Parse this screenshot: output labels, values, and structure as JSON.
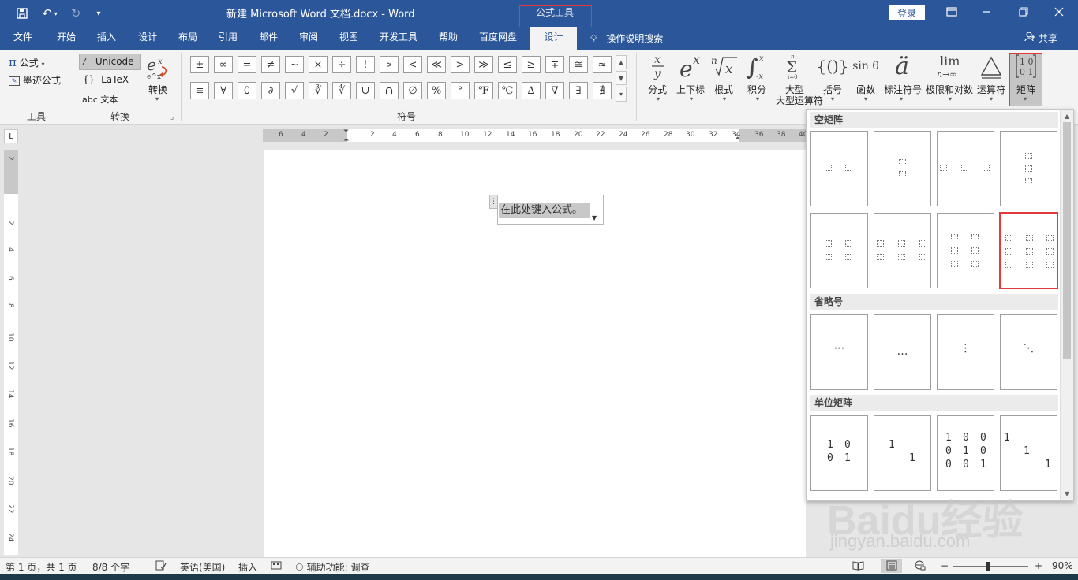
{
  "titlebar": {
    "doc_title": "新建 Microsoft Word 文档.docx  -  Word",
    "context_tool": "公式工具",
    "login": "登录"
  },
  "tabs": [
    "文件",
    "开始",
    "插入",
    "设计",
    "布局",
    "引用",
    "邮件",
    "审阅",
    "视图",
    "开发工具",
    "帮助",
    "百度网盘",
    "设计"
  ],
  "active_tab": "设计",
  "tell_me": "操作说明搜索",
  "share": "共享",
  "ribbon": {
    "tools": {
      "equation": "公式",
      "ink_equation": "墨迹公式",
      "group": "工具"
    },
    "conversions": {
      "unicode": "Unicode",
      "latex": "LaTeX",
      "text": "abc 文本",
      "convert": "转换",
      "group": "转换"
    },
    "symbols": {
      "group": "符号",
      "row1": [
        "±",
        "∞",
        "=",
        "≠",
        "~",
        "×",
        "÷",
        "!",
        "∝",
        "<",
        "≪",
        ">",
        "≫",
        "≤",
        "≥",
        "∓",
        "≅",
        "≈"
      ],
      "row2": [
        "≡",
        "∀",
        "∁",
        "∂",
        "√",
        "∛",
        "∜",
        "∪",
        "∩",
        "∅",
        "%",
        "°",
        "℉",
        "℃",
        "∆",
        "∇",
        "∃",
        "∄"
      ]
    },
    "structures": [
      {
        "icon": "x/y",
        "label": "分式"
      },
      {
        "icon": "e^x",
        "label": "上下标"
      },
      {
        "icon": "ⁿ√x",
        "label": "根式"
      },
      {
        "icon": "∫",
        "label": "积分"
      },
      {
        "icon": "Σ",
        "label": "大型运算符"
      },
      {
        "icon": "{()}",
        "label": "括号"
      },
      {
        "icon": "sin θ",
        "label": "函数"
      },
      {
        "icon": "ä",
        "label": "标注符号"
      },
      {
        "icon": "lim",
        "label": "极限和对数"
      },
      {
        "icon": "Δ",
        "label": "运算符"
      },
      {
        "icon": "[10/01]",
        "label": "矩阵"
      }
    ]
  },
  "ruler": {
    "h_numbers": [
      "6",
      "4",
      "2",
      "2",
      "4",
      "6",
      "8",
      "10",
      "12",
      "14",
      "16",
      "18",
      "20",
      "22",
      "24",
      "26",
      "28",
      "30",
      "32",
      "34",
      "36",
      "38",
      "40"
    ],
    "v_numbers": [
      "2",
      "2",
      "4",
      "6",
      "8",
      "10",
      "12",
      "14",
      "16",
      "18",
      "20",
      "22",
      "24"
    ],
    "tab_selector": "L"
  },
  "document": {
    "equation_placeholder": "在此处键入公式。"
  },
  "gallery": {
    "sections": [
      "空矩阵",
      "省略号",
      "单位矩阵"
    ],
    "identity_2x2": [
      "1",
      "0",
      "0",
      "1"
    ],
    "identity_2x2_empty": [
      "1",
      "1"
    ],
    "identity_3x3": [
      "1",
      "0",
      "0",
      "0",
      "1",
      "0",
      "0",
      "0",
      "1"
    ],
    "identity_3x3_empty": [
      "1",
      "1",
      "1"
    ],
    "dots": [
      "⋯",
      "…",
      "⋮",
      "⋱"
    ]
  },
  "statusbar": {
    "page": "第 1 页，共 1 页",
    "words": "8/8 个字",
    "language": "英语(美国)",
    "insert_mode": "插入",
    "accessibility": "辅助功能: 调查",
    "zoom": "90%"
  },
  "watermark": {
    "line1": "Baidu经验",
    "line2": "jingyan.baidu.com"
  },
  "colors": {
    "brand": "#2b579a",
    "highlight": "#e23a3a",
    "ribbon_bg": "#f3f3f3"
  }
}
